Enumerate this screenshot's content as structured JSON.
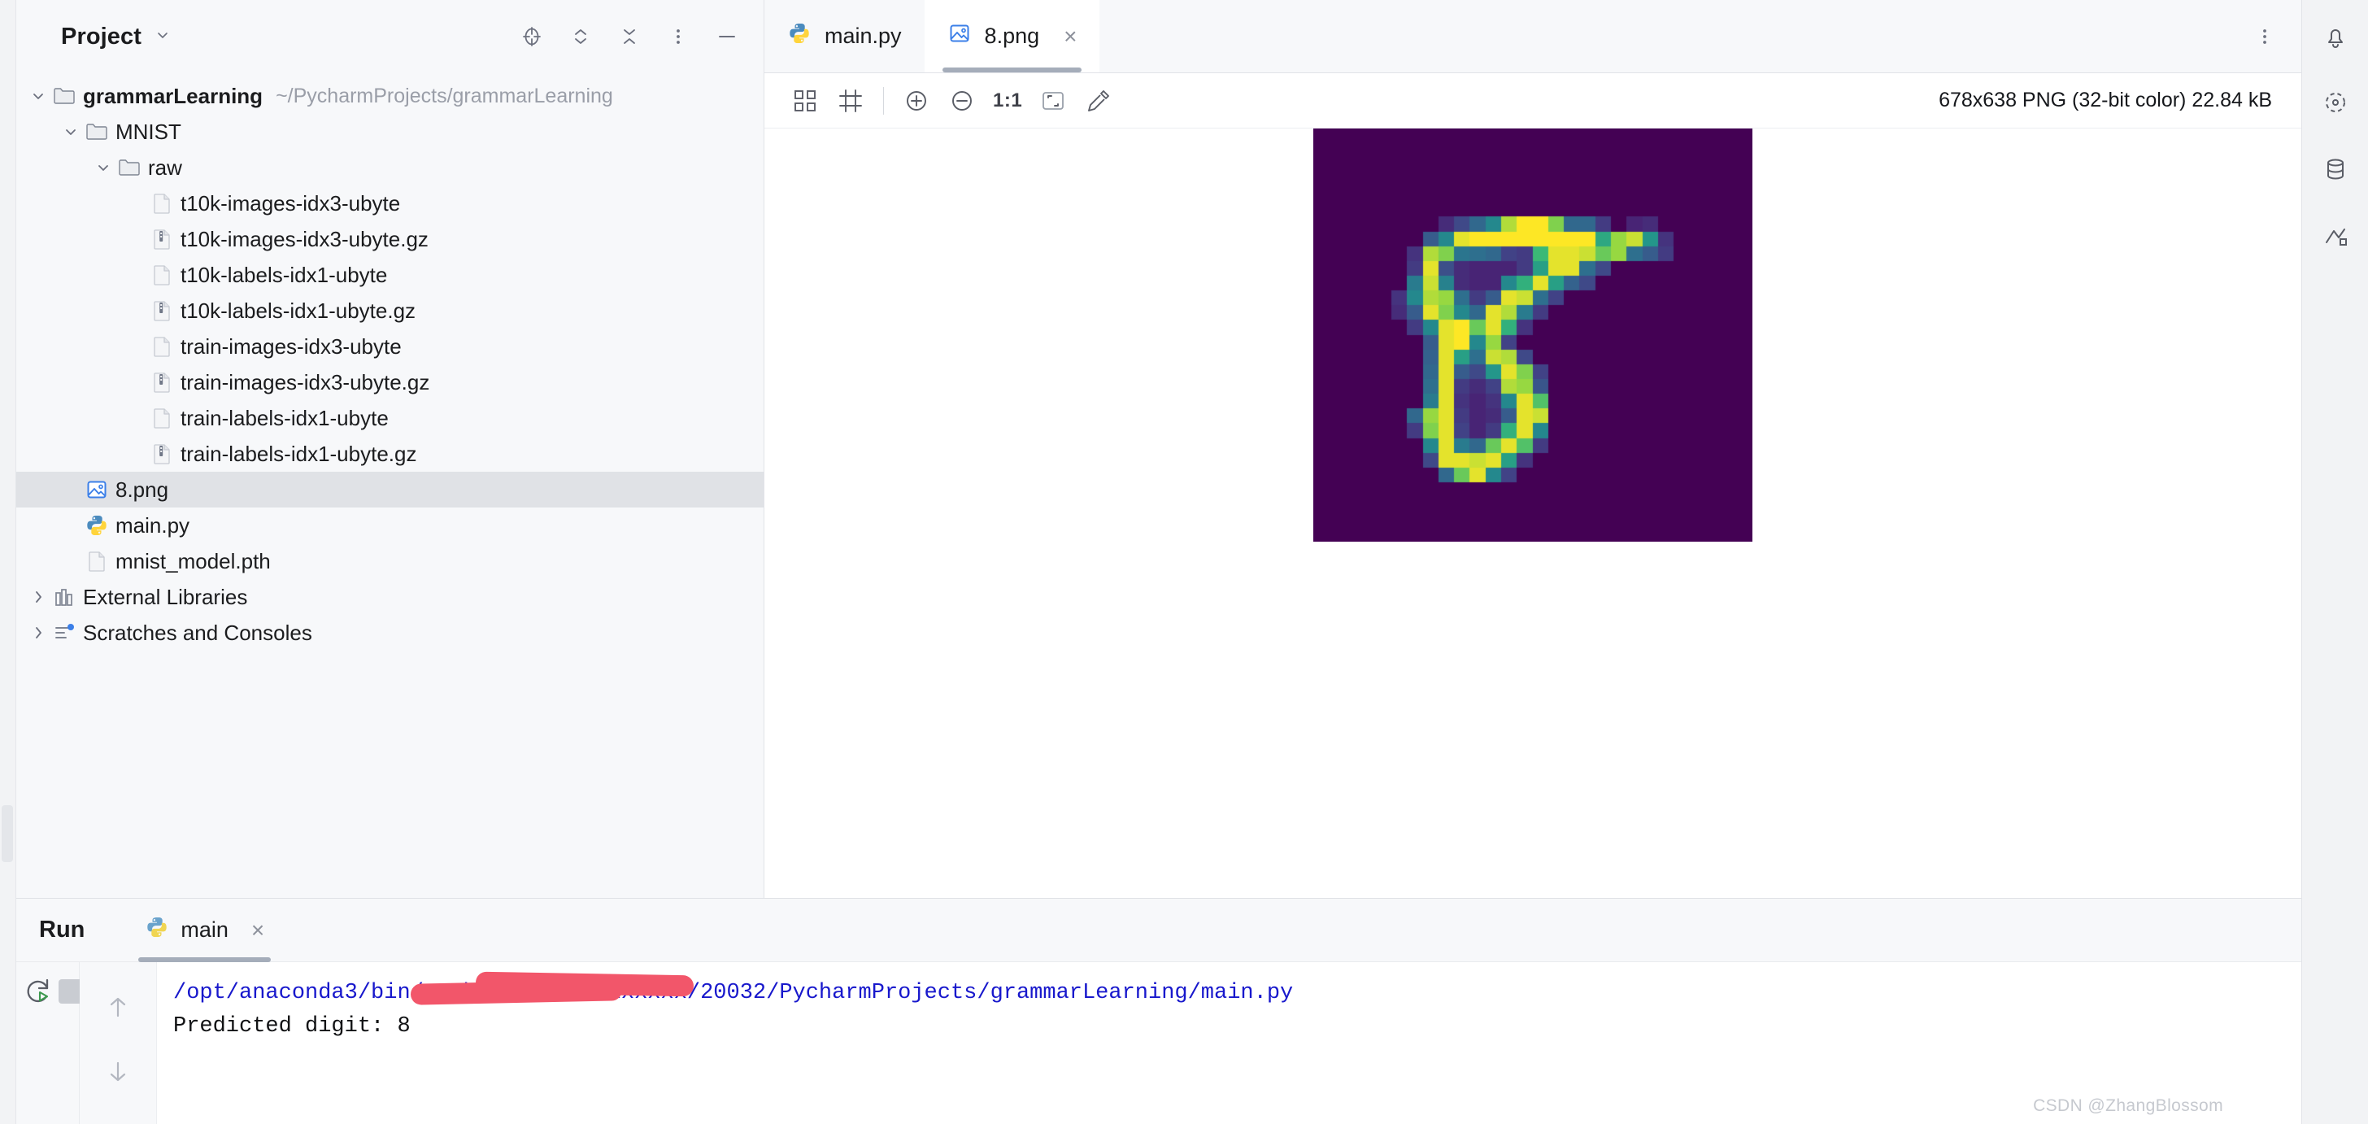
{
  "project": {
    "title": "Project",
    "collapse_chevron": "chevron-down",
    "header_icons": [
      "locate-icon",
      "expand-collapse-icon",
      "collapse-all-icon",
      "more-options-icon",
      "minimize-icon"
    ],
    "tree": [
      {
        "label": "grammarLearning",
        "path": "~/PycharmProjects/grammarLearning",
        "icon": "folder-icon",
        "twist": "expanded",
        "indent": 0,
        "bold": true,
        "selected": false
      },
      {
        "label": "MNIST",
        "path": "",
        "icon": "folder-icon",
        "twist": "expanded",
        "indent": 1,
        "bold": false,
        "selected": false
      },
      {
        "label": "raw",
        "path": "",
        "icon": "folder-icon",
        "twist": "expanded",
        "indent": 2,
        "bold": false,
        "selected": false
      },
      {
        "label": "t10k-images-idx3-ubyte",
        "path": "",
        "icon": "file-icon",
        "twist": "none",
        "indent": 3,
        "bold": false,
        "selected": false
      },
      {
        "label": "t10k-images-idx3-ubyte.gz",
        "path": "",
        "icon": "archive-icon",
        "twist": "none",
        "indent": 3,
        "bold": false,
        "selected": false
      },
      {
        "label": "t10k-labels-idx1-ubyte",
        "path": "",
        "icon": "file-icon",
        "twist": "none",
        "indent": 3,
        "bold": false,
        "selected": false
      },
      {
        "label": "t10k-labels-idx1-ubyte.gz",
        "path": "",
        "icon": "archive-icon",
        "twist": "none",
        "indent": 3,
        "bold": false,
        "selected": false
      },
      {
        "label": "train-images-idx3-ubyte",
        "path": "",
        "icon": "file-icon",
        "twist": "none",
        "indent": 3,
        "bold": false,
        "selected": false
      },
      {
        "label": "train-images-idx3-ubyte.gz",
        "path": "",
        "icon": "archive-icon",
        "twist": "none",
        "indent": 3,
        "bold": false,
        "selected": false
      },
      {
        "label": "train-labels-idx1-ubyte",
        "path": "",
        "icon": "file-icon",
        "twist": "none",
        "indent": 3,
        "bold": false,
        "selected": false
      },
      {
        "label": "train-labels-idx1-ubyte.gz",
        "path": "",
        "icon": "archive-icon",
        "twist": "none",
        "indent": 3,
        "bold": false,
        "selected": false
      },
      {
        "label": "8.png",
        "path": "",
        "icon": "image-file-icon",
        "twist": "none",
        "indent": 1,
        "bold": false,
        "selected": true
      },
      {
        "label": "main.py",
        "path": "",
        "icon": "python-file-icon",
        "twist": "none",
        "indent": 1,
        "bold": false,
        "selected": false
      },
      {
        "label": "mnist_model.pth",
        "path": "",
        "icon": "file-icon",
        "twist": "none",
        "indent": 1,
        "bold": false,
        "selected": false
      },
      {
        "label": "External Libraries",
        "path": "",
        "icon": "library-icon",
        "twist": "collapsed",
        "indent": 0,
        "bold": false,
        "selected": false
      },
      {
        "label": "Scratches and Consoles",
        "path": "",
        "icon": "scratches-icon",
        "twist": "collapsed",
        "indent": 0,
        "bold": false,
        "selected": false
      }
    ]
  },
  "editor": {
    "tabs": [
      {
        "label": "main.py",
        "icon": "python-file-icon",
        "active": false,
        "closable": false
      },
      {
        "label": "8.png",
        "icon": "image-file-icon",
        "active": true,
        "closable": true,
        "close_glyph": "×"
      }
    ],
    "tabbar_more": "more-options-icon",
    "image_toolbar": {
      "buttons": [
        "toggle-transparency-grid-icon",
        "toggle-image-border-icon",
        "zoom-in-icon",
        "zoom-out-icon",
        "fit-to-window-icon",
        "color-picker-icon"
      ],
      "zoom_ratio": "1:1"
    },
    "image_info": "678x638 PNG (32-bit color) 22.84 kB"
  },
  "right_rail": {
    "icons": [
      "notifications-icon",
      "ai-assistant-icon",
      "database-icon",
      "gradle-icon"
    ]
  },
  "run_panel": {
    "title": "Run",
    "tab_label": "main",
    "tab_icon": "python-file-icon",
    "tab_close_glyph": "×",
    "toolbar": [
      "rerun-icon",
      "stop-icon",
      "more-options-icon"
    ],
    "gutter": [
      "scroll-up-icon",
      "scroll-down-icon"
    ],
    "console": {
      "command_prefix": "/opt/anaconda3/bin/python ",
      "command_redacted": "/Users/xxxxxx/20032/PycharmProjects/grammarLearning/main.py",
      "command_suffix": "ts/grammarLearning/main.py",
      "output_line": "Predicted digit: 8",
      "command_color": "#1818cc",
      "output_color": "#111214",
      "redaction_color": "#f2566a"
    }
  },
  "watermark": "CSDN @ZhangBlossom",
  "colors": {
    "panel_bg": "#f7f8fa",
    "editor_bg": "#ffffff",
    "selection_bg": "#e0e2e6",
    "tab_underline": "#a5adba",
    "text": "#1b1c1e",
    "muted_text": "#9a9ea8"
  },
  "digit_image": {
    "colormap": "viridis",
    "grid": 28,
    "background_value": 0,
    "predicted_digit": 8,
    "pixels": [
      [
        0,
        0,
        0,
        0,
        0,
        0,
        0,
        0,
        0,
        0,
        0,
        0,
        0,
        0,
        0,
        0,
        0,
        0,
        0,
        0,
        0,
        0,
        0,
        0,
        0,
        0,
        0,
        0
      ],
      [
        0,
        0,
        0,
        0,
        0,
        0,
        0,
        0,
        0,
        0,
        0,
        0,
        0,
        0,
        0,
        0,
        0,
        0,
        0,
        0,
        0,
        0,
        0,
        0,
        0,
        0,
        0,
        0
      ],
      [
        0,
        0,
        0,
        0,
        0,
        0,
        0,
        0,
        0,
        0,
        0,
        0,
        0,
        0,
        0,
        0,
        0,
        0,
        0,
        0,
        0,
        0,
        0,
        0,
        0,
        0,
        0,
        0
      ],
      [
        0,
        0,
        0,
        0,
        0,
        0,
        0,
        0,
        0,
        0,
        0,
        0,
        0,
        0,
        0,
        0,
        0,
        0,
        0,
        0,
        0,
        0,
        0,
        0,
        0,
        0,
        0,
        0
      ],
      [
        0,
        0,
        0,
        0,
        0,
        0,
        0,
        0,
        0,
        0,
        0,
        0,
        0,
        0,
        0,
        0,
        0,
        0,
        0,
        0,
        0,
        0,
        0,
        0,
        0,
        0,
        0,
        0
      ],
      [
        0,
        0,
        0,
        0,
        0,
        0,
        0,
        0,
        0,
        0,
        0,
        0,
        0,
        0,
        0,
        0,
        0,
        0,
        0,
        0,
        0,
        0,
        0,
        0,
        0,
        0,
        0,
        0
      ],
      [
        0,
        0,
        0,
        0,
        0,
        0,
        0,
        0,
        25,
        45,
        70,
        95,
        150,
        165,
        165,
        140,
        70,
        70,
        35,
        0,
        20,
        25,
        0,
        0,
        0,
        0,
        0,
        0
      ],
      [
        0,
        0,
        0,
        0,
        0,
        0,
        0,
        60,
        95,
        160,
        165,
        165,
        165,
        165,
        165,
        165,
        165,
        165,
        115,
        145,
        155,
        105,
        30,
        0,
        0,
        0,
        0,
        0
      ],
      [
        0,
        0,
        0,
        0,
        0,
        0,
        30,
        150,
        140,
        80,
        75,
        70,
        40,
        35,
        125,
        160,
        160,
        155,
        135,
        145,
        75,
        60,
        35,
        0,
        0,
        0,
        0,
        0
      ],
      [
        0,
        0,
        0,
        0,
        0,
        0,
        35,
        160,
        50,
        25,
        20,
        20,
        20,
        35,
        110,
        160,
        160,
        75,
        45,
        0,
        0,
        0,
        0,
        0,
        0,
        0,
        0,
        0
      ],
      [
        0,
        0,
        0,
        0,
        0,
        0,
        85,
        155,
        90,
        25,
        20,
        20,
        95,
        120,
        160,
        110,
        65,
        45,
        0,
        0,
        0,
        0,
        0,
        0,
        0,
        0,
        0,
        0
      ],
      [
        0,
        0,
        0,
        0,
        0,
        30,
        95,
        150,
        145,
        75,
        35,
        60,
        160,
        155,
        75,
        40,
        0,
        0,
        0,
        0,
        0,
        0,
        0,
        0,
        0,
        0,
        0,
        0
      ],
      [
        0,
        0,
        0,
        0,
        0,
        25,
        60,
        160,
        140,
        95,
        70,
        160,
        150,
        85,
        35,
        0,
        0,
        0,
        0,
        0,
        0,
        0,
        0,
        0,
        0,
        0,
        0,
        0
      ],
      [
        0,
        0,
        0,
        0,
        0,
        0,
        35,
        95,
        160,
        165,
        135,
        160,
        120,
        30,
        0,
        0,
        0,
        0,
        0,
        0,
        0,
        0,
        0,
        0,
        0,
        0,
        0,
        0
      ],
      [
        0,
        0,
        0,
        0,
        0,
        0,
        0,
        60,
        160,
        165,
        95,
        145,
        40,
        0,
        0,
        0,
        0,
        0,
        0,
        0,
        0,
        0,
        0,
        0,
        0,
        0,
        0,
        0
      ],
      [
        0,
        0,
        0,
        0,
        0,
        0,
        0,
        65,
        160,
        110,
        75,
        155,
        150,
        45,
        0,
        0,
        0,
        0,
        0,
        0,
        0,
        0,
        0,
        0,
        0,
        0,
        0,
        0
      ],
      [
        0,
        0,
        0,
        0,
        0,
        0,
        0,
        70,
        160,
        60,
        45,
        105,
        160,
        140,
        40,
        0,
        0,
        0,
        0,
        0,
        0,
        0,
        0,
        0,
        0,
        0,
        0,
        0
      ],
      [
        0,
        0,
        0,
        0,
        0,
        0,
        0,
        75,
        160,
        35,
        25,
        40,
        150,
        145,
        55,
        0,
        0,
        0,
        0,
        0,
        0,
        0,
        0,
        0,
        0,
        0,
        0,
        0
      ],
      [
        0,
        0,
        0,
        0,
        0,
        0,
        0,
        85,
        160,
        30,
        20,
        30,
        95,
        160,
        130,
        0,
        0,
        0,
        0,
        0,
        0,
        0,
        0,
        0,
        0,
        0,
        0,
        0
      ],
      [
        0,
        0,
        0,
        0,
        0,
        0,
        70,
        145,
        160,
        35,
        20,
        25,
        60,
        160,
        155,
        0,
        0,
        0,
        0,
        0,
        0,
        0,
        0,
        0,
        0,
        0,
        0,
        0
      ],
      [
        0,
        0,
        0,
        0,
        0,
        0,
        35,
        140,
        160,
        40,
        20,
        35,
        120,
        160,
        95,
        0,
        0,
        0,
        0,
        0,
        0,
        0,
        0,
        0,
        0,
        0,
        0,
        0
      ],
      [
        0,
        0,
        0,
        0,
        0,
        0,
        0,
        95,
        160,
        85,
        70,
        135,
        160,
        130,
        35,
        0,
        0,
        0,
        0,
        0,
        0,
        0,
        0,
        0,
        0,
        0,
        0,
        0
      ],
      [
        0,
        0,
        0,
        0,
        0,
        0,
        0,
        45,
        160,
        160,
        155,
        160,
        110,
        30,
        0,
        0,
        0,
        0,
        0,
        0,
        0,
        0,
        0,
        0,
        0,
        0,
        0,
        0
      ],
      [
        0,
        0,
        0,
        0,
        0,
        0,
        0,
        0,
        70,
        135,
        160,
        95,
        40,
        0,
        0,
        0,
        0,
        0,
        0,
        0,
        0,
        0,
        0,
        0,
        0,
        0,
        0,
        0
      ],
      [
        0,
        0,
        0,
        0,
        0,
        0,
        0,
        0,
        0,
        0,
        0,
        0,
        0,
        0,
        0,
        0,
        0,
        0,
        0,
        0,
        0,
        0,
        0,
        0,
        0,
        0,
        0,
        0
      ],
      [
        0,
        0,
        0,
        0,
        0,
        0,
        0,
        0,
        0,
        0,
        0,
        0,
        0,
        0,
        0,
        0,
        0,
        0,
        0,
        0,
        0,
        0,
        0,
        0,
        0,
        0,
        0,
        0
      ],
      [
        0,
        0,
        0,
        0,
        0,
        0,
        0,
        0,
        0,
        0,
        0,
        0,
        0,
        0,
        0,
        0,
        0,
        0,
        0,
        0,
        0,
        0,
        0,
        0,
        0,
        0,
        0,
        0
      ],
      [
        0,
        0,
        0,
        0,
        0,
        0,
        0,
        0,
        0,
        0,
        0,
        0,
        0,
        0,
        0,
        0,
        0,
        0,
        0,
        0,
        0,
        0,
        0,
        0,
        0,
        0,
        0,
        0
      ]
    ]
  }
}
